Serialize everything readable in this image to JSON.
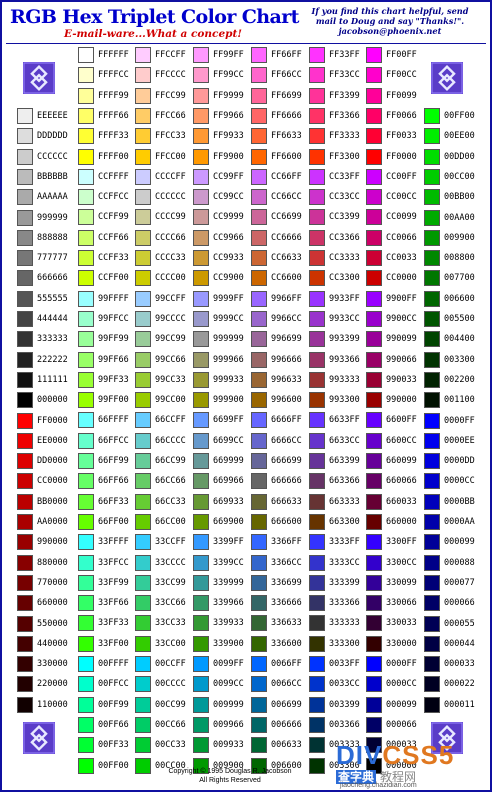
{
  "header": {
    "title": "RGB Hex Triplet Color Chart",
    "subtitle": "E-mail-ware...What a concept!",
    "note_lines": [
      "If you find this chart helpful, send",
      "mail to Doug and say \"Thanks!\".",
      "jacobson@phoenix.net"
    ]
  },
  "footer": {
    "copyright": "Copyright © 1995 Douglas R. Jacobson",
    "rights": "All Rights Reserved"
  },
  "watermark": {
    "brand_a": "DIV",
    "brand_b": "CSS",
    "brand_c": "5",
    "cn1": "查字典",
    "cn2": "教程网",
    "url": "jiaocheng.chazidian.com"
  },
  "colors": {
    "border": "#1010a0",
    "title": "#0000cc",
    "subtitle": "#d00000"
  },
  "columns": [
    [
      "EEEEEE",
      "DDDDDD",
      "CCCCCC",
      "BBBBBB",
      "AAAAAA",
      "999999",
      "888888",
      "777777",
      "666666",
      "555555",
      "444444",
      "333333",
      "222222",
      "111111",
      "000000",
      "FF0000",
      "EE0000",
      "DD0000",
      "CC0000",
      "BB0000",
      "AA0000",
      "990000",
      "880000",
      "770000",
      "660000",
      "550000",
      "440000",
      "330000",
      "220000",
      "110000"
    ],
    [
      "FFFFFF",
      "FFFFCC",
      "FFFF99",
      "FFFF66",
      "FFFF33",
      "FFFF00",
      "CCFFFF",
      "CCFFCC",
      "CCFF99",
      "CCFF66",
      "CCFF33",
      "CCFF00",
      "99FFFF",
      "99FFCC",
      "99FF99",
      "99FF66",
      "99FF33",
      "99FF00",
      "66FFFF",
      "66FFCC",
      "66FF99",
      "66FF66",
      "66FF33",
      "66FF00",
      "33FFFF",
      "33FFCC",
      "33FF99",
      "33FF66",
      "33FF33",
      "33FF00",
      "00FFFF",
      "00FFCC",
      "00FF99",
      "00FF66",
      "00FF33",
      "00FF00"
    ],
    [
      "FFCCFF",
      "FFCCCC",
      "FFCC99",
      "FFCC66",
      "FFCC33",
      "FFCC00",
      "CCCCFF",
      "CCCCCC",
      "CCCC99",
      "CCCC66",
      "CCCC33",
      "CCCC00",
      "99CCFF",
      "99CCCC",
      "99CC99",
      "99CC66",
      "99CC33",
      "99CC00",
      "66CCFF",
      "66CCCC",
      "66CC99",
      "66CC66",
      "66CC33",
      "66CC00",
      "33CCFF",
      "33CCCC",
      "33CC99",
      "33CC66",
      "33CC33",
      "33CC00",
      "00CCFF",
      "00CCCC",
      "00CC99",
      "00CC66",
      "00CC33",
      "00CC00"
    ],
    [
      "FF99FF",
      "FF99CC",
      "FF9999",
      "FF9966",
      "FF9933",
      "FF9900",
      "CC99FF",
      "CC99CC",
      "CC9999",
      "CC9966",
      "CC9933",
      "CC9900",
      "9999FF",
      "9999CC",
      "999999",
      "999966",
      "999933",
      "999900",
      "6699FF",
      "6699CC",
      "669999",
      "669966",
      "669933",
      "669900",
      "3399FF",
      "3399CC",
      "339999",
      "339966",
      "339933",
      "339900",
      "0099FF",
      "0099CC",
      "009999",
      "009966",
      "009933",
      "009900"
    ],
    [
      "FF66FF",
      "FF66CC",
      "FF6699",
      "FF6666",
      "FF6633",
      "FF6600",
      "CC66FF",
      "CC66CC",
      "CC6699",
      "CC6666",
      "CC6633",
      "CC6600",
      "9966FF",
      "9966CC",
      "996699",
      "996666",
      "996633",
      "996600",
      "6666FF",
      "6666CC",
      "666699",
      "666666",
      "666633",
      "666600",
      "3366FF",
      "3366CC",
      "336699",
      "336666",
      "336633",
      "336600",
      "0066FF",
      "0066CC",
      "006699",
      "006666",
      "006633",
      "006600"
    ],
    [
      "FF33FF",
      "FF33CC",
      "FF3399",
      "FF3366",
      "FF3333",
      "FF3300",
      "CC33FF",
      "CC33CC",
      "CC3399",
      "CC3366",
      "CC3333",
      "CC3300",
      "9933FF",
      "9933CC",
      "993399",
      "993366",
      "993333",
      "993300",
      "6633FF",
      "6633CC",
      "663399",
      "663366",
      "663333",
      "663300",
      "3333FF",
      "3333CC",
      "333399",
      "333366",
      "333333",
      "333300",
      "0033FF",
      "0033CC",
      "003399",
      "003366",
      "003333",
      "003300"
    ],
    [
      "FF00FF",
      "FF00CC",
      "FF0099",
      "FF0066",
      "FF0033",
      "FF0000",
      "CC00FF",
      "CC00CC",
      "CC0099",
      "CC0066",
      "CC0033",
      "CC0000",
      "9900FF",
      "9900CC",
      "990099",
      "990066",
      "990033",
      "990000",
      "6600FF",
      "6600CC",
      "660099",
      "660066",
      "660033",
      "660000",
      "3300FF",
      "3300CC",
      "330099",
      "330066",
      "330033",
      "330000",
      "0000FF",
      "0000CC",
      "000099",
      "000066",
      "000033",
      "000000"
    ],
    [
      "00FF00",
      "00EE00",
      "00DD00",
      "00CC00",
      "00BB00",
      "00AA00",
      "009900",
      "008800",
      "007700",
      "006600",
      "005500",
      "004400",
      "003300",
      "002200",
      "001100",
      "0000FF",
      "0000EE",
      "0000DD",
      "0000CC",
      "0000BB",
      "0000AA",
      "000099",
      "000088",
      "000077",
      "000066",
      "000055",
      "000044",
      "000033",
      "000022",
      "000011"
    ]
  ]
}
